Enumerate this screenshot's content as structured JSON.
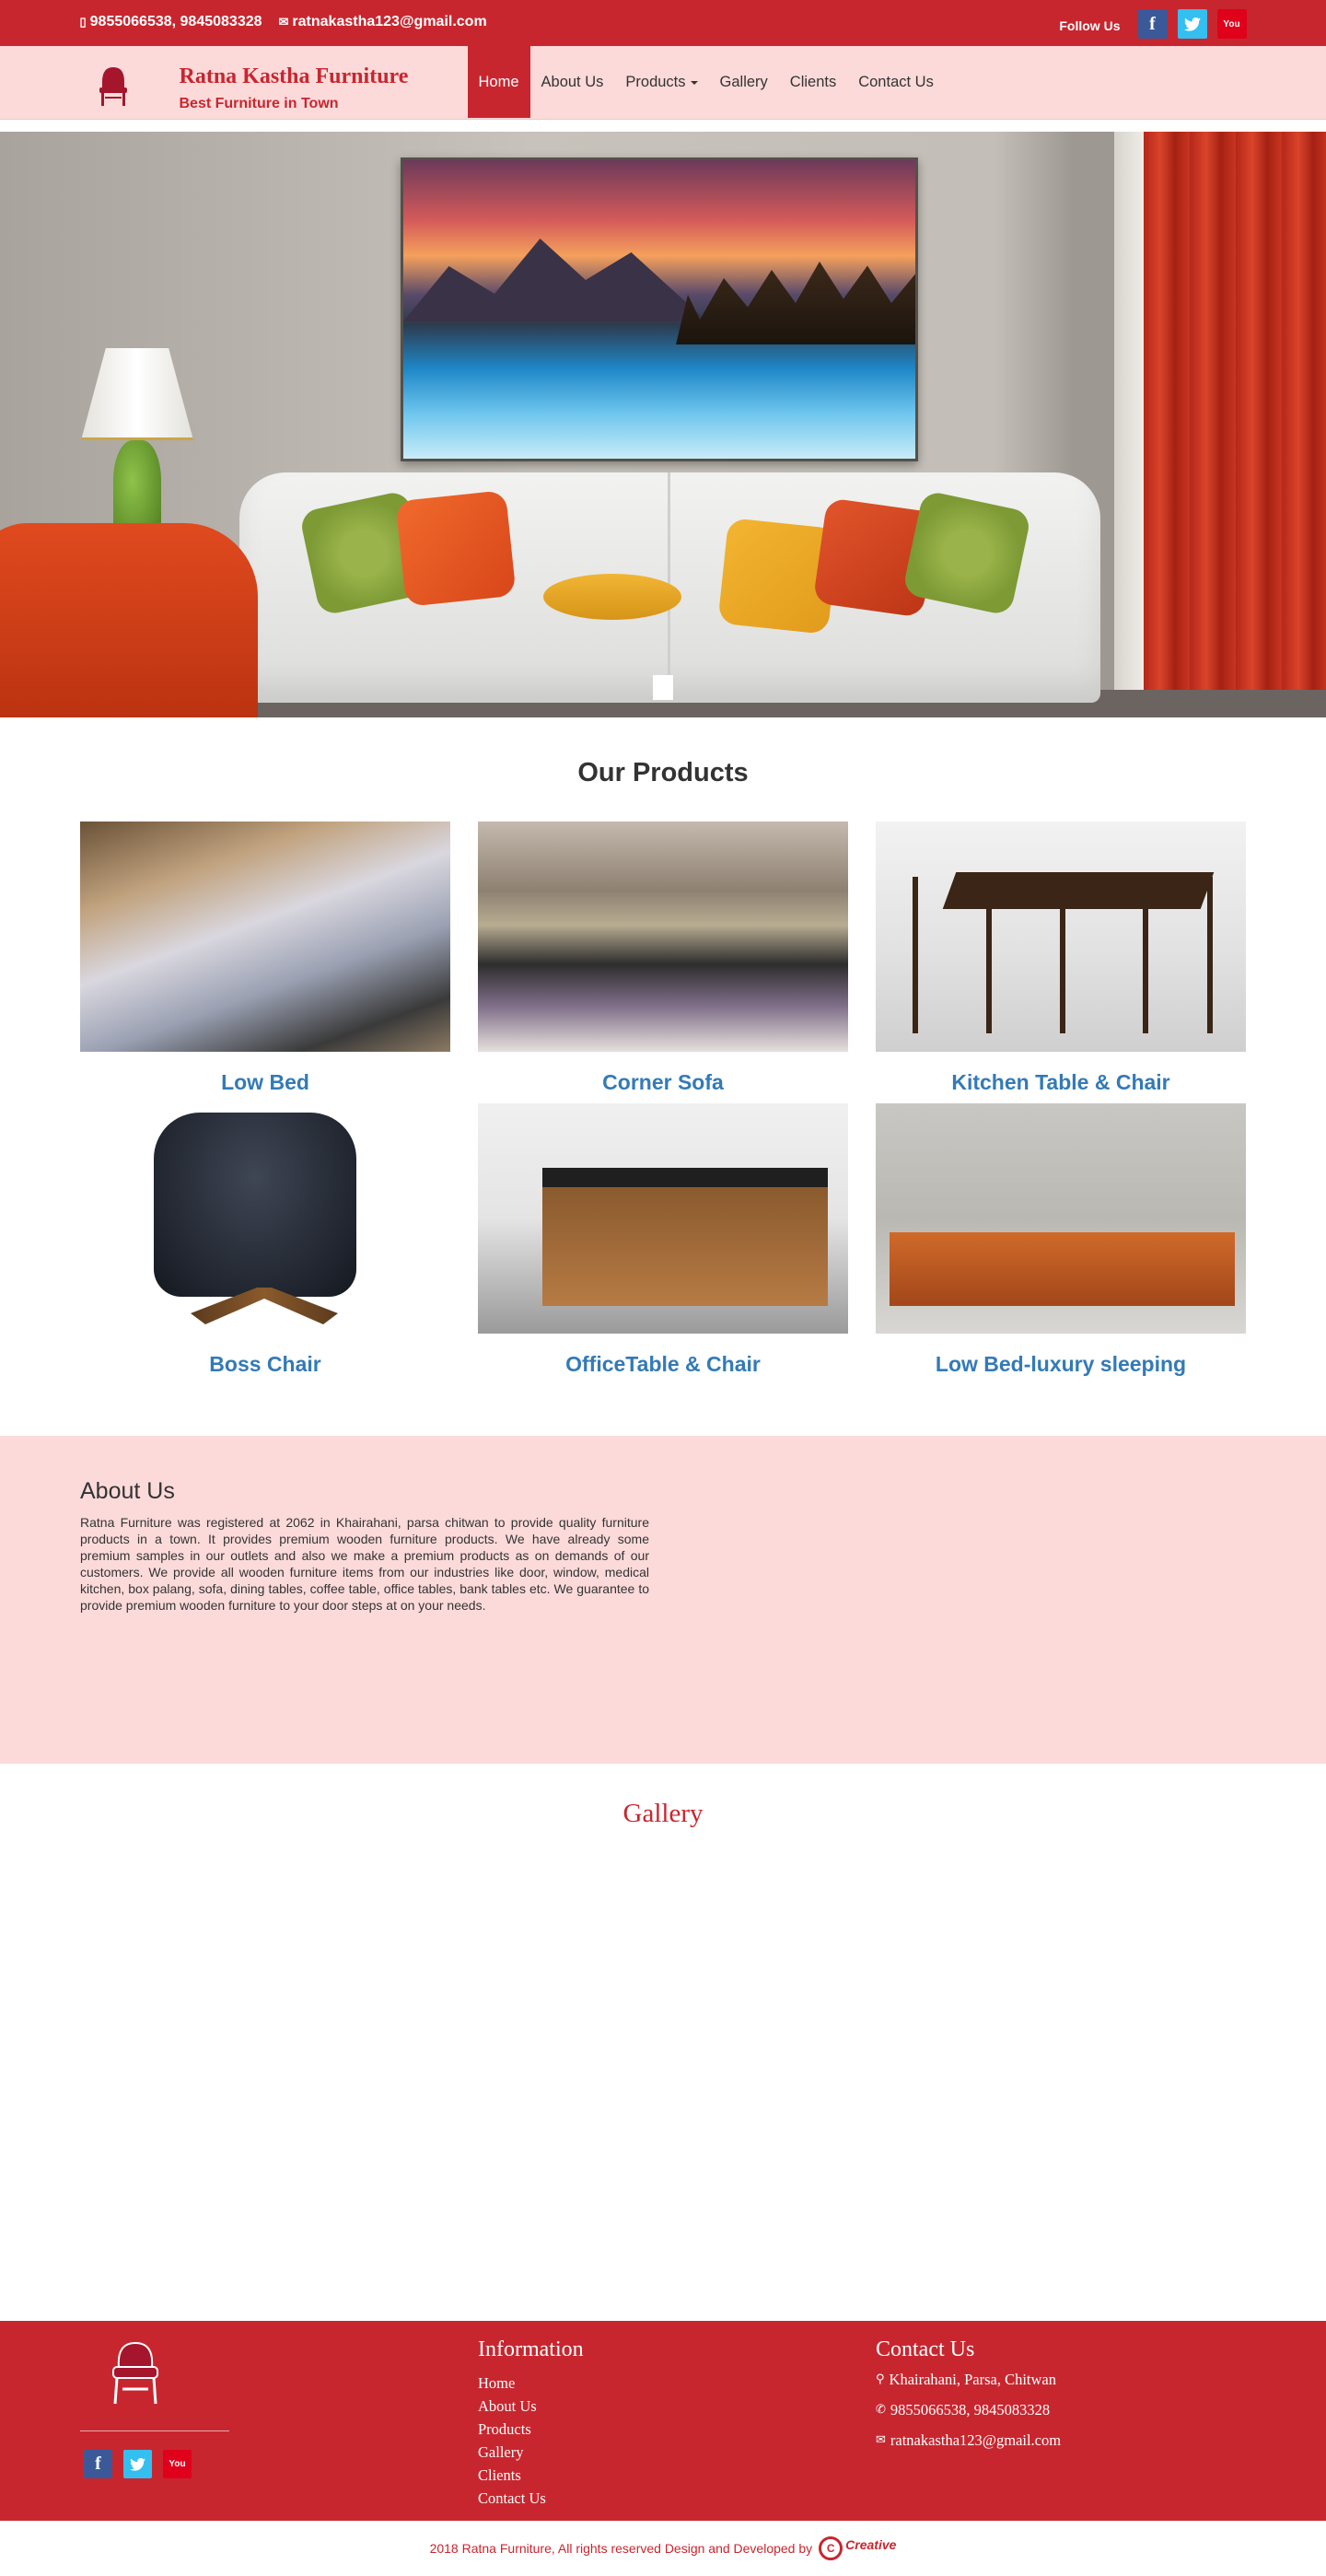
{
  "topbar": {
    "phone": "9855066538, 9845083328",
    "email": "ratnakastha123@gmail.com",
    "follow_label": "Follow Us",
    "social": {
      "facebook": "f",
      "twitter": "t",
      "youtube": "You"
    }
  },
  "brand": {
    "name": "Ratna Kastha Furniture",
    "tagline": "Best Furniture in Town"
  },
  "nav": {
    "home": "Home",
    "about": "About Us",
    "products": "Products",
    "gallery": "Gallery",
    "clients": "Clients",
    "contact": "Contact Us"
  },
  "products": {
    "title": "Our Products",
    "items": [
      {
        "name": "Low Bed",
        "image": "low-bed-image"
      },
      {
        "name": "Corner Sofa",
        "image": "corner-sofa-image"
      },
      {
        "name": "Kitchen Table & Chair",
        "image": "kitchen-table-image"
      },
      {
        "name": "Boss Chair",
        "image": "boss-chair-image"
      },
      {
        "name": "OfficeTable & Chair",
        "image": "office-table-image"
      },
      {
        "name": "Low Bed-luxury sleeping",
        "image": "luxury-bed-image"
      }
    ]
  },
  "about": {
    "title": "About Us",
    "body": "Ratna Furniture was registered at 2062 in Khairahani, parsa chitwan to provide quality furniture products in a town. It provides premium wooden furniture products. We have already some premium samples in our outlets and also we make a premium products as on demands of our customers. We provide all wooden furniture items from our industries like door, window, medical kitchen, box palang, sofa, dining tables, coffee table, office tables, bank tables etc. We guarantee to provide premium wooden furniture to your door steps at on your needs."
  },
  "gallery": {
    "title": "Gallery"
  },
  "footer": {
    "info_title": "Information",
    "info_links": [
      "Home",
      "About Us",
      "Products",
      "Gallery",
      "Clients",
      "Contact Us"
    ],
    "contact_title": "Contact Us",
    "address": "Khairahani, Parsa, Chitwan",
    "phone": "9855066538, 9845083328",
    "email": "ratnakastha123@gmail.com",
    "copyright": "2018 Ratna Furniture, All rights reserved Design and Developed by",
    "credit": "Creative"
  },
  "colors": {
    "brand_red": "#c8262f",
    "pink_bg": "#fcdada",
    "link_blue": "#337ab7"
  }
}
